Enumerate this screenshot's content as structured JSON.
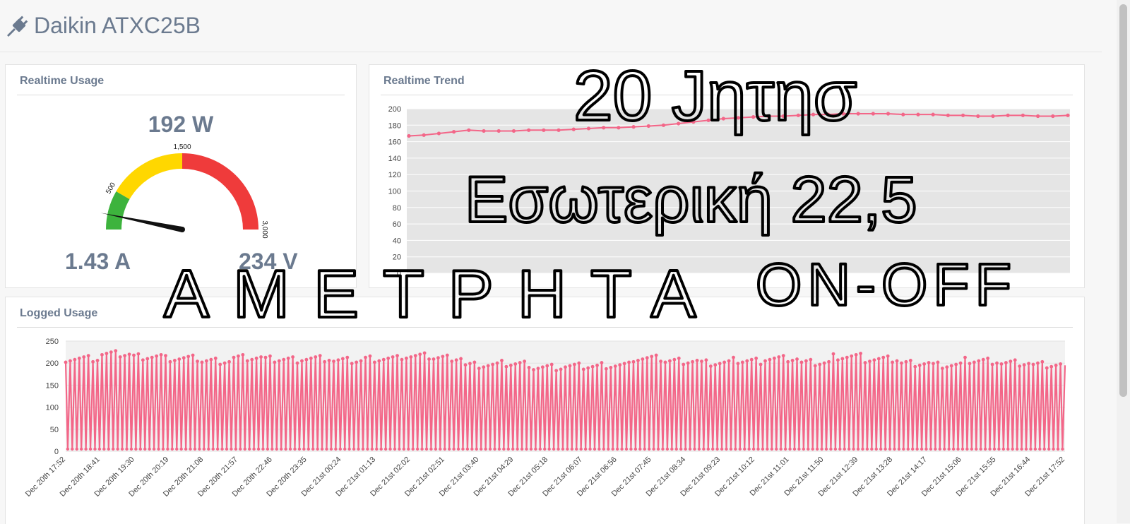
{
  "header": {
    "title": "Daikin ATXC25B",
    "icon": "plug-icon"
  },
  "realtime_usage": {
    "title": "Realtime Usage",
    "watts": "192 W",
    "amps": "1.43 A",
    "volts": "234 V",
    "gauge": {
      "min": 0,
      "max": 3000,
      "value": 192,
      "labels": [
        "500",
        "1,500",
        "3,000"
      ],
      "bands": [
        {
          "from": 0,
          "to": 500,
          "color": "#3db33d"
        },
        {
          "from": 500,
          "to": 1500,
          "color": "#ffd700"
        },
        {
          "from": 1500,
          "to": 3000,
          "color": "#ef3b3b"
        }
      ]
    }
  },
  "realtime_trend": {
    "title": "Realtime Trend"
  },
  "logged_usage": {
    "title": "Logged Usage"
  },
  "annotations": {
    "line1": "20 Jητησ",
    "line2": "Εσωτερική 22,5",
    "line3": "ΑΜΕΤΡΗΤΑ",
    "line4": "ΟΝ-ΟFF"
  },
  "colors": {
    "series": "#f36688",
    "fill": "#e5e5e5",
    "grid": "#e2e2e2",
    "text": "#6b7a8f"
  },
  "chart_data": [
    {
      "type": "line",
      "title": "Realtime Trend",
      "ylim": [
        0,
        200
      ],
      "yticks": [
        "0",
        "20",
        "40",
        "60",
        "80",
        "100",
        "120",
        "140",
        "160",
        "180",
        "200"
      ],
      "series": [
        {
          "values": [
            167,
            168,
            170,
            172,
            174,
            173,
            173,
            173,
            174,
            174,
            174,
            175,
            176,
            177,
            177,
            178,
            179,
            180,
            182,
            184,
            186,
            188,
            189,
            190,
            191,
            191,
            192,
            193,
            193,
            194,
            194,
            194,
            194,
            193,
            193,
            193,
            192,
            192,
            191,
            191,
            192,
            192,
            191,
            191,
            192
          ]
        }
      ]
    },
    {
      "type": "line",
      "title": "Logged Usage",
      "ylim": [
        0,
        250
      ],
      "yticks": [
        "0",
        "50",
        "100",
        "150",
        "200",
        "250"
      ],
      "categories": [
        "Dec 20th 17:52",
        "Dec 20th 18:41",
        "Dec 20th 19:30",
        "Dec 20th 20:19",
        "Dec 20th 21:08",
        "Dec 20th 21:57",
        "Dec 20th 22:46",
        "Dec 20th 23:35",
        "Dec 21st 00:24",
        "Dec 21st 01:13",
        "Dec 21st 02:02",
        "Dec 21st 02:51",
        "Dec 21st 03:40",
        "Dec 21st 04:29",
        "Dec 21st 05:18",
        "Dec 21st 06:07",
        "Dec 21st 06:56",
        "Dec 21st 07:45",
        "Dec 21st 08:34",
        "Dec 21st 09:23",
        "Dec 21st 10:12",
        "Dec 21st 11:01",
        "Dec 21st 11:50",
        "Dec 21st 12:39",
        "Dec 21st 13:28",
        "Dec 21st 14:17",
        "Dec 21st 15:06",
        "Dec 21st 15:55",
        "Dec 21st 16:44",
        "Dec 21st 17:52"
      ],
      "series": [
        {
          "pattern": "on-off cycling",
          "peak_values": [
            210,
            220,
            215,
            210,
            205,
            212,
            208,
            210,
            205,
            210,
            215,
            212,
            195,
            198,
            190,
            192,
            195,
            210,
            205,
            200,
            205,
            210,
            200,
            215,
            208,
            200,
            195,
            205,
            200,
            195
          ],
          "low_value": 5
        }
      ]
    }
  ]
}
